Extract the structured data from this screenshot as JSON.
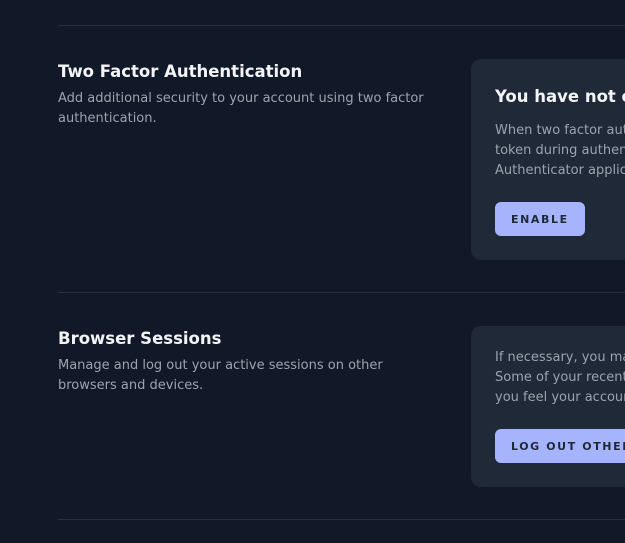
{
  "two_factor": {
    "title": "Two Factor Authentication",
    "description": "Add additional security to your account using two factor authentication.",
    "card": {
      "heading": "You have not en",
      "lines": [
        "When two factor aut",
        "token during authent",
        "Authenticator applica"
      ],
      "enable_label": "ENABLE"
    }
  },
  "browser_sessions": {
    "title": "Browser Sessions",
    "description": "Manage and log out your active sessions on other browsers and devices.",
    "card": {
      "lines": [
        "If necessary, you may",
        "Some of your recent",
        "you feel your accoun"
      ],
      "logout_label": "LOG OUT OTHER"
    }
  },
  "colors": {
    "background": "#111827",
    "card": "#1f2937",
    "accent_button": "#a5b4fc",
    "divider": "#253142"
  }
}
